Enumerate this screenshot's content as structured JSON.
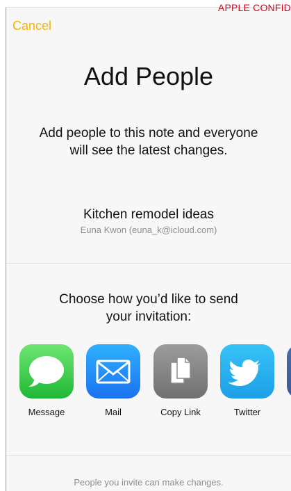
{
  "banner": {
    "confidential": "APPLE CONFID"
  },
  "nav": {
    "cancel_label": "Cancel"
  },
  "header": {
    "title": "Add People",
    "intro": "Add people to this note and everyone will see the latest changes."
  },
  "note": {
    "title": "Kitchen remodel ideas",
    "owner": "Euna Kwon (euna_k@icloud.com)"
  },
  "share": {
    "prompt": "Choose how you’d like to send your invitation:",
    "options": [
      {
        "label": "Message",
        "icon": "message-icon",
        "color": "#34c759"
      },
      {
        "label": "Mail",
        "icon": "mail-icon",
        "color": "#1a82fb"
      },
      {
        "label": "Copy Link",
        "icon": "copy-link-icon",
        "color": "#8a8a8a"
      },
      {
        "label": "Twitter",
        "icon": "twitter-icon",
        "color": "#1da1f2"
      },
      {
        "label": "",
        "icon": "facebook-icon",
        "color": "#3b5998"
      }
    ]
  },
  "footer": {
    "note": "People you invite can make changes."
  },
  "colors": {
    "accent": "#f2b400",
    "confidential": "#d0021b",
    "secondary_text": "#8e8e93"
  }
}
